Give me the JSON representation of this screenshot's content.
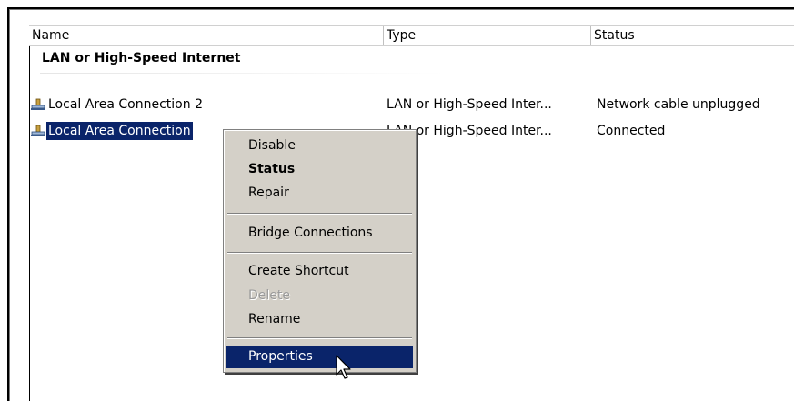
{
  "columns": {
    "name": "Name",
    "type": "Type",
    "status": "Status"
  },
  "group": {
    "title": "LAN or High-Speed Internet"
  },
  "connections": [
    {
      "name": "Local Area Connection 2",
      "type": "LAN or High-Speed Inter...",
      "status": "Network cable unplugged",
      "icon": "network-connection-icon"
    },
    {
      "name": "Local Area Connection",
      "type": "LAN or High-Speed Inter...",
      "status": "Connected",
      "icon": "network-connection-icon",
      "selected": true
    }
  ],
  "context_menu": {
    "items": [
      {
        "label": "Disable"
      },
      {
        "label": "Status",
        "bold": true
      },
      {
        "label": "Repair"
      },
      {
        "label": "Bridge Connections"
      },
      {
        "label": "Create Shortcut"
      },
      {
        "label": "Delete",
        "disabled": true
      },
      {
        "label": "Rename"
      },
      {
        "label": "Properties",
        "highlighted": true
      }
    ]
  },
  "colors": {
    "selection": "#0a246a",
    "menu_background": "#d4d0c8"
  }
}
